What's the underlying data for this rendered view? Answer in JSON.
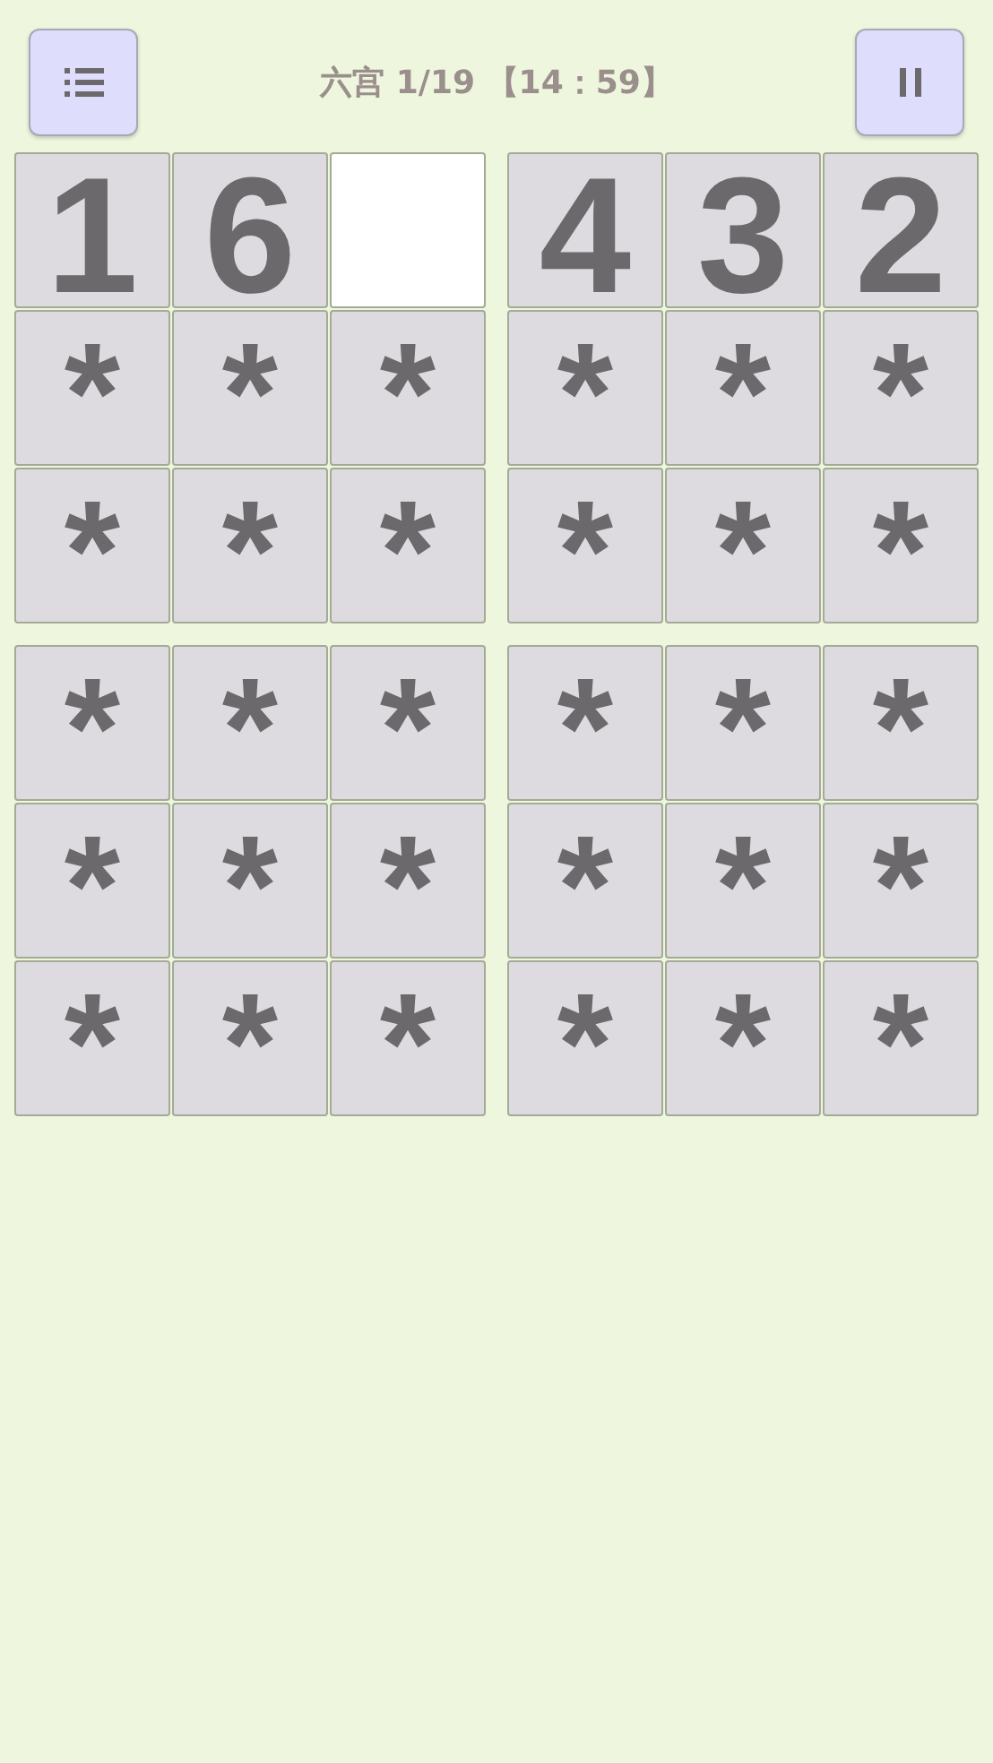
{
  "header": {
    "title": "六宫 1/19 【14：59】"
  },
  "rows": [
    [
      {
        "kind": "digit",
        "value": "1"
      },
      {
        "kind": "digit",
        "value": "6"
      },
      {
        "kind": "empty"
      },
      {
        "kind": "digit",
        "value": "4"
      },
      {
        "kind": "digit",
        "value": "3"
      },
      {
        "kind": "digit",
        "value": "2"
      }
    ],
    [
      {
        "kind": "hidden",
        "value": "*"
      },
      {
        "kind": "hidden",
        "value": "*"
      },
      {
        "kind": "hidden",
        "value": "*"
      },
      {
        "kind": "hidden",
        "value": "*"
      },
      {
        "kind": "hidden",
        "value": "*"
      },
      {
        "kind": "hidden",
        "value": "*"
      }
    ],
    [
      {
        "kind": "hidden",
        "value": "*"
      },
      {
        "kind": "hidden",
        "value": "*"
      },
      {
        "kind": "hidden",
        "value": "*"
      },
      {
        "kind": "hidden",
        "value": "*"
      },
      {
        "kind": "hidden",
        "value": "*"
      },
      {
        "kind": "hidden",
        "value": "*"
      }
    ],
    [
      {
        "kind": "hidden",
        "value": "*"
      },
      {
        "kind": "hidden",
        "value": "*"
      },
      {
        "kind": "hidden",
        "value": "*"
      },
      {
        "kind": "hidden",
        "value": "*"
      },
      {
        "kind": "hidden",
        "value": "*"
      },
      {
        "kind": "hidden",
        "value": "*"
      }
    ],
    [
      {
        "kind": "hidden",
        "value": "*"
      },
      {
        "kind": "hidden",
        "value": "*"
      },
      {
        "kind": "hidden",
        "value": "*"
      },
      {
        "kind": "hidden",
        "value": "*"
      },
      {
        "kind": "hidden",
        "value": "*"
      },
      {
        "kind": "hidden",
        "value": "*"
      }
    ],
    [
      {
        "kind": "hidden",
        "value": "*"
      },
      {
        "kind": "hidden",
        "value": "*"
      },
      {
        "kind": "hidden",
        "value": "*"
      },
      {
        "kind": "hidden",
        "value": "*"
      },
      {
        "kind": "hidden",
        "value": "*"
      },
      {
        "kind": "hidden",
        "value": "*"
      }
    ]
  ]
}
